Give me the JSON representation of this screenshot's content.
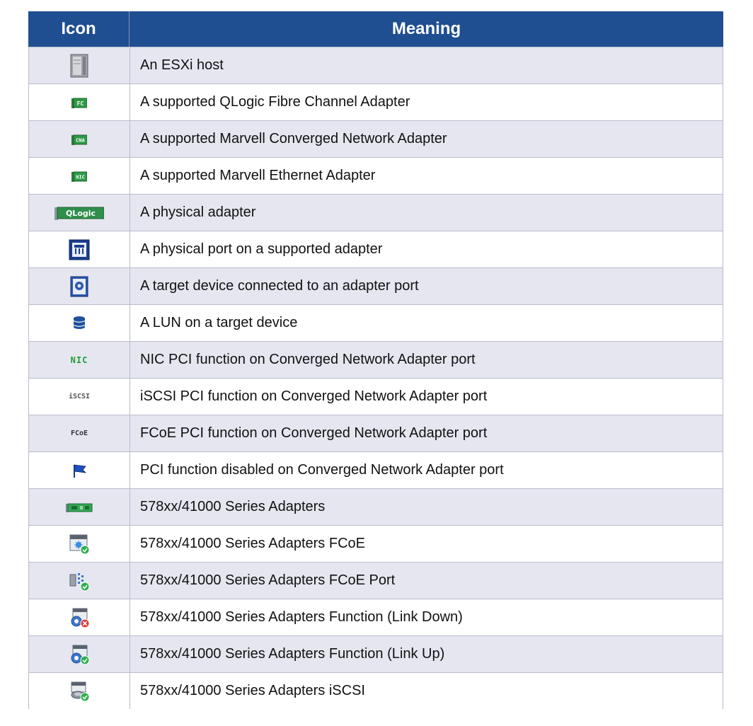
{
  "table": {
    "headers": {
      "icon": "Icon",
      "meaning": "Meaning"
    },
    "rows": [
      {
        "icon": "esxi-host-icon",
        "meaning": "An ESXi host"
      },
      {
        "icon": "fc-adapter-icon",
        "icon_text": "FC",
        "meaning": "A supported QLogic Fibre Channel Adapter"
      },
      {
        "icon": "cna-adapter-icon",
        "icon_text": "CNA",
        "meaning": "A supported Marvell Converged Network Adapter"
      },
      {
        "icon": "nic-adapter-icon",
        "icon_text": "NIC",
        "meaning": "A supported Marvell Ethernet Adapter"
      },
      {
        "icon": "physical-adapter-icon",
        "icon_text": "QLogic",
        "meaning": "A physical adapter"
      },
      {
        "icon": "physical-port-icon",
        "meaning": "A physical port on a supported adapter"
      },
      {
        "icon": "target-device-icon",
        "meaning": "A target device connected to an adapter port"
      },
      {
        "icon": "lun-icon",
        "meaning": "A LUN on a target device"
      },
      {
        "icon": "nic-function-icon",
        "icon_text": "NIC",
        "meaning": "NIC PCI function on Converged Network Adapter port"
      },
      {
        "icon": "iscsi-function-icon",
        "icon_text": "iSCSI",
        "meaning": "iSCSI PCI function on Converged Network Adapter port"
      },
      {
        "icon": "fcoe-function-icon",
        "icon_text": "FCoE",
        "meaning": "FCoE PCI function on Converged Network Adapter port"
      },
      {
        "icon": "disabled-function-icon",
        "meaning": "PCI function disabled on Converged Network Adapter port"
      },
      {
        "icon": "series-adapter-icon",
        "meaning": "578xx/41000 Series Adapters"
      },
      {
        "icon": "series-fcoe-icon",
        "meaning": "578xx/41000 Series Adapters FCoE"
      },
      {
        "icon": "series-fcoe-port-icon",
        "meaning": "578xx/41000 Series Adapters FCoE Port"
      },
      {
        "icon": "series-function-link-down-icon",
        "meaning": "578xx/41000 Series Adapters Function (Link Down)"
      },
      {
        "icon": "series-function-link-up-icon",
        "meaning": "578xx/41000 Series Adapters Function (Link Up)"
      },
      {
        "icon": "series-iscsi-icon",
        "meaning": "578xx/41000 Series Adapters iSCSI"
      }
    ]
  },
  "colors": {
    "header_bg": "#1f4e91",
    "header_text": "#ffffff",
    "alt_row_bg": "#e5e6f0",
    "border": "#b9bccb"
  }
}
